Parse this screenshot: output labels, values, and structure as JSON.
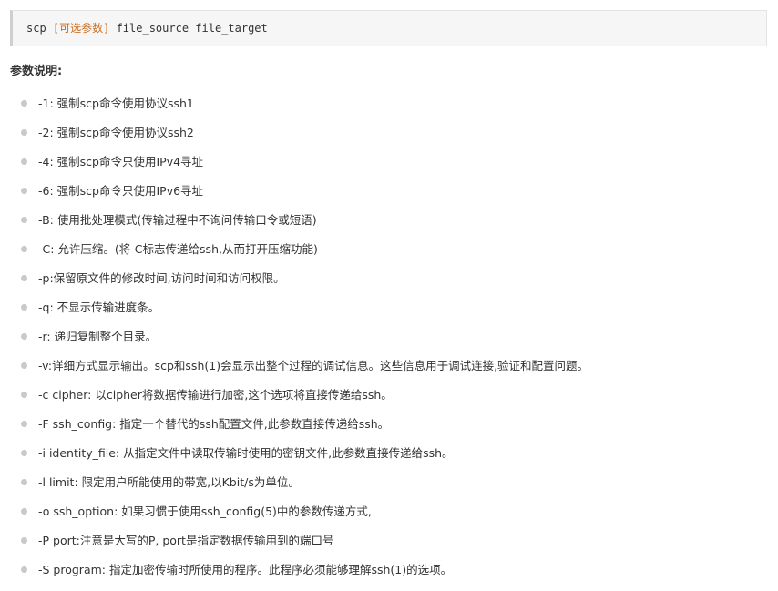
{
  "code": {
    "cmd": "scp ",
    "optional": "[可选参数]",
    "args": " file_source file_target"
  },
  "section_title": "参数说明:",
  "params": [
    "-1: 强制scp命令使用协议ssh1",
    "-2: 强制scp命令使用协议ssh2",
    "-4: 强制scp命令只使用IPv4寻址",
    "-6: 强制scp命令只使用IPv6寻址",
    "-B: 使用批处理模式(传输过程中不询问传输口令或短语)",
    "-C: 允许压缩。(将-C标志传递给ssh,从而打开压缩功能)",
    "-p:保留原文件的修改时间,访问时间和访问权限。",
    "-q: 不显示传输进度条。",
    "-r: 递归复制整个目录。",
    "-v:详细方式显示输出。scp和ssh(1)会显示出整个过程的调试信息。这些信息用于调试连接,验证和配置问题。",
    "-c cipher: 以cipher将数据传输进行加密,这个选项将直接传递给ssh。",
    "-F ssh_config: 指定一个替代的ssh配置文件,此参数直接传递给ssh。",
    "-i identity_file: 从指定文件中读取传输时使用的密钥文件,此参数直接传递给ssh。",
    "-l limit: 限定用户所能使用的带宽,以Kbit/s为单位。",
    "-o ssh_option: 如果习惯于使用ssh_config(5)中的参数传递方式,",
    "-P port:注意是大写的P, port是指定数据传输用到的端口号",
    "-S program: 指定加密传输时所使用的程序。此程序必须能够理解ssh(1)的选项。"
  ]
}
